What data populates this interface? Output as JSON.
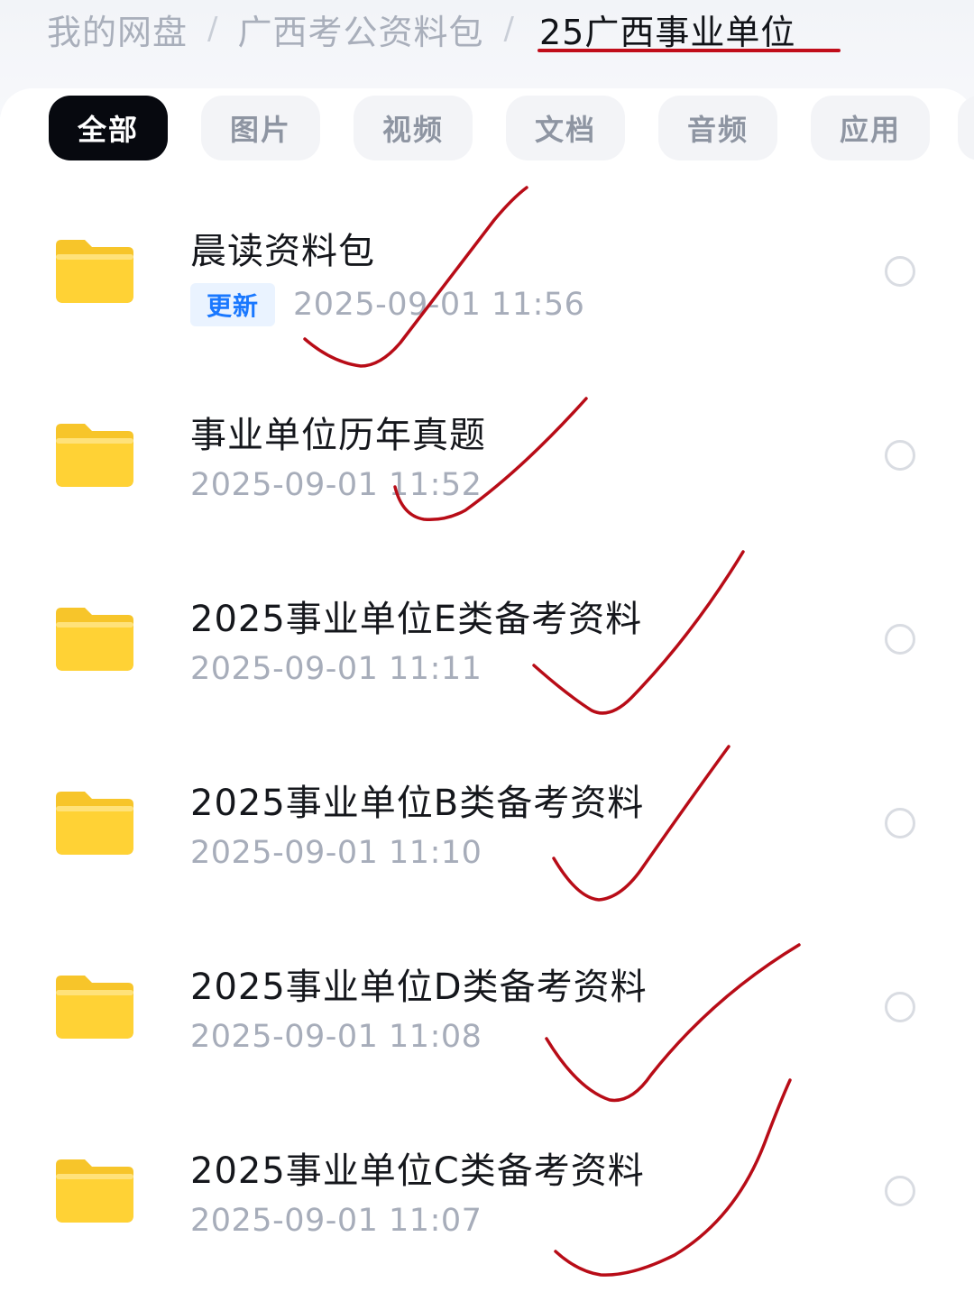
{
  "breadcrumb": {
    "root": "我的网盘",
    "parent": "广西考公资料包",
    "current": "25广西事业单位",
    "separator": "/"
  },
  "tabs": [
    {
      "label": "全部",
      "active": true
    },
    {
      "label": "图片",
      "active": false
    },
    {
      "label": "视频",
      "active": false
    },
    {
      "label": "文档",
      "active": false
    },
    {
      "label": "音频",
      "active": false
    },
    {
      "label": "应用",
      "active": false
    }
  ],
  "files": [
    {
      "name": "晨读资料包",
      "date": "2025-09-01 11:56",
      "badge": "更新"
    },
    {
      "name": "事业单位历年真题",
      "date": "2025-09-01 11:52",
      "badge": ""
    },
    {
      "name": "2025事业单位E类备考资料",
      "date": "2025-09-01 11:11",
      "badge": ""
    },
    {
      "name": "2025事业单位B类备考资料",
      "date": "2025-09-01 11:10",
      "badge": ""
    },
    {
      "name": "2025事业单位D类备考资料",
      "date": "2025-09-01 11:08",
      "badge": ""
    },
    {
      "name": "2025事业单位C类备考资料",
      "date": "2025-09-01 11:07",
      "badge": ""
    }
  ],
  "icons": {
    "folder": "folder-icon",
    "select": "select-circle-icon"
  },
  "colors": {
    "folder_body": "#ffd235",
    "folder_tab": "#f7c52a",
    "badge_text": "#1a78ff",
    "active_tab": "#07090f",
    "annotation_ink": "#b80c17"
  }
}
